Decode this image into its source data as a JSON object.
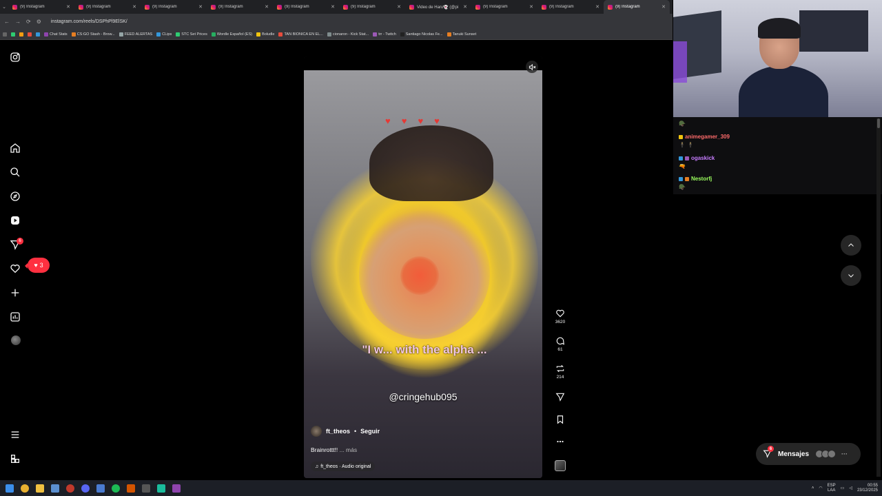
{
  "browser": {
    "tabs": [
      {
        "title": "(9) Instagram"
      },
      {
        "title": "(9) Instagram"
      },
      {
        "title": "(9) Instagram"
      },
      {
        "title": "(9) Instagram"
      },
      {
        "title": "(9) Instagram"
      },
      {
        "title": "(9) Instagram"
      },
      {
        "title": "Video de Haru👻 (@pi"
      },
      {
        "title": "(9) Instagram"
      },
      {
        "title": "(9) Instagram"
      },
      {
        "title": "(9) Instagram"
      }
    ],
    "active_tab_index": 9,
    "url": "instagram.com/reels/DSPhPl9ElSK/",
    "bookmarks": [
      "Chat Stats",
      "CS:GO Stash - Brow...",
      "FEED ALERTAS",
      "CLips",
      "STC Set Prices",
      "Wordle Español (ES)",
      "Boludle",
      "TAN BIONICA EN EL...",
      "cionaron - Kick Stat...",
      "trr - Twitch",
      "Santiago Nicolas Fe...",
      "Tanuki Sunset"
    ]
  },
  "instagram": {
    "sidebar": {
      "notification_badge": "6",
      "likes_count": "3"
    },
    "reel": {
      "overlay_caption": "\"I w... with the alpha ...",
      "overlay_handle": "@cringehub095",
      "author": "ft_theos",
      "separator": "•",
      "follow_label": "Seguir",
      "caption": "Brainrottt!!",
      "more_label": "... más",
      "audio": "ft_theos · Audio original"
    },
    "actions": {
      "likes": "3620",
      "comments": "61",
      "reposts": "214"
    },
    "messages": {
      "label": "Mensajes",
      "badge": "6",
      "more": "···"
    }
  },
  "stream_chat": {
    "messages": [
      {
        "user": "animegamer_309",
        "color": "#ff6b6b",
        "text": "🕴 🕴"
      },
      {
        "user": "ogaskick",
        "color": "#c77dff",
        "text": "🔫"
      },
      {
        "user": "Nestorfj",
        "color": "#9cff5f",
        "text": "🪖"
      }
    ]
  },
  "taskbar": {
    "language_top": "ESP",
    "language_bottom": "LAA",
    "time": "00:55",
    "date": "23/12/2025"
  },
  "colors": {
    "instagram_red": "#ff3040",
    "background": "#000000"
  }
}
